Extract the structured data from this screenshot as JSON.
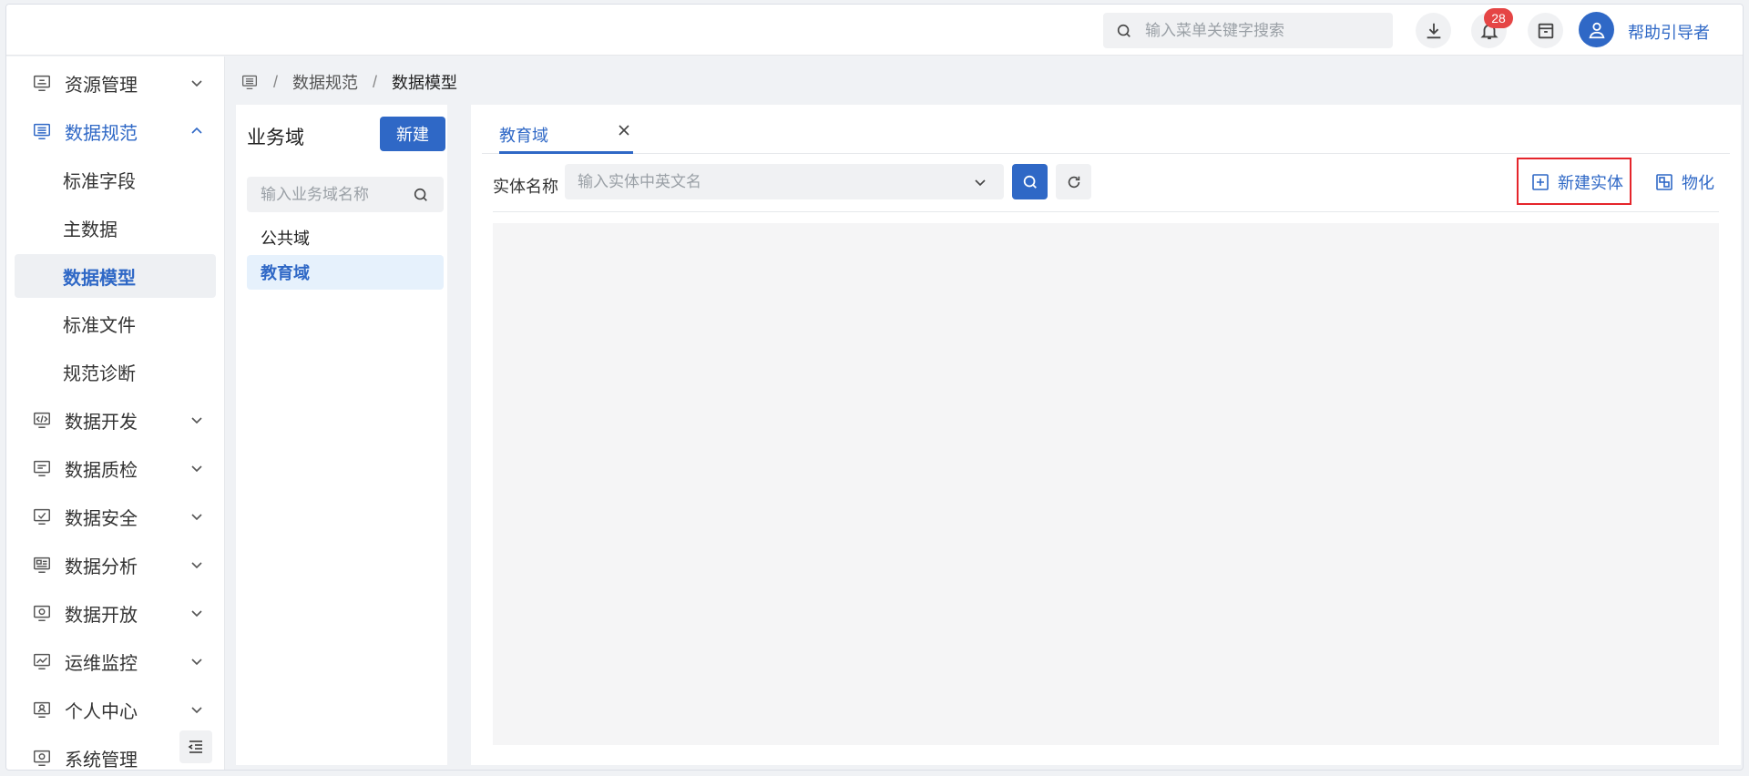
{
  "header": {
    "search_placeholder": "输入菜单关键字搜索",
    "notification_count": "28",
    "username": "帮助引导者",
    "icons": [
      "search-icon",
      "download-icon",
      "bell-icon",
      "archive-icon",
      "user-icon"
    ]
  },
  "sidebar": {
    "items": [
      {
        "label": "资源管理",
        "icon": "monitor-icon",
        "expanded": false
      },
      {
        "label": "数据规范",
        "icon": "data-standard-icon",
        "expanded": true,
        "children": [
          "标准字段",
          "主数据",
          "数据模型",
          "标准文件",
          "规范诊断"
        ]
      },
      {
        "label": "数据开发",
        "icon": "code-icon",
        "expanded": false
      },
      {
        "label": "数据质检",
        "icon": "quality-icon",
        "expanded": false
      },
      {
        "label": "数据安全",
        "icon": "security-icon",
        "expanded": false
      },
      {
        "label": "数据分析",
        "icon": "analysis-icon",
        "expanded": false
      },
      {
        "label": "数据开放",
        "icon": "open-icon",
        "expanded": false
      },
      {
        "label": "运维监控",
        "icon": "monitor-chart-icon",
        "expanded": false
      },
      {
        "label": "个人中心",
        "icon": "user-card-icon",
        "expanded": false
      },
      {
        "label": "系统管理",
        "icon": "settings-icon",
        "expanded": false
      }
    ],
    "active_child": "数据模型"
  },
  "breadcrumb": {
    "separator": "/",
    "items": [
      "数据规范",
      "数据模型"
    ]
  },
  "domain_panel": {
    "title": "业务域",
    "new_label": "新建",
    "search_placeholder": "输入业务域名称",
    "items": [
      "公共域",
      "教育域"
    ],
    "active": "教育域"
  },
  "main": {
    "tabs": [
      {
        "label": "教育域",
        "closable": true
      }
    ],
    "filter_label": "实体名称",
    "filter_placeholder": "输入实体中英文名",
    "new_entity_label": "新建实体",
    "materialize_label": "物化"
  },
  "colors": {
    "primary": "#2f68c6",
    "badge": "#e54545",
    "highlight_border": "#e5252b"
  }
}
